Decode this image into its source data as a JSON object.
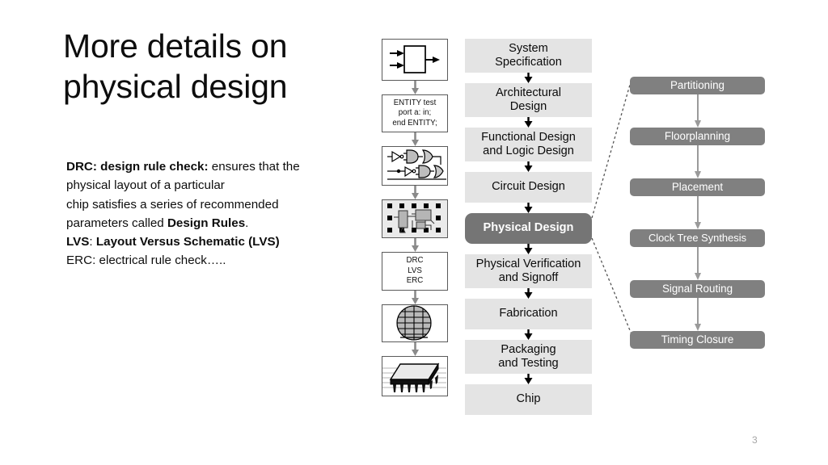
{
  "slide": {
    "title": "More details on physical design",
    "page_number": "3",
    "body": {
      "line1_bold": "DRC: design rule check:",
      "line1_rest": " ensures that  the",
      "line2": "physical layout of a particular",
      "line3": "chip  satisfies a series of recommended",
      "line4_pre": "parameters called ",
      "line4_bold": "Design Rules",
      "line4_post": ".",
      "line5_bold_a": "LVS",
      "line5_rest": ": ",
      "line5_bold_b": "Layout Versus Schematic (LVS)",
      "line6": "ERC: electrical rule check….."
    }
  },
  "colors": {
    "center_box": "#e4e4e4",
    "center_highlight": "#757575",
    "right_box": "#808080",
    "icon_border": "#5a5a5a",
    "arrow": "#7f7f7f",
    "text_dark": "#0b0b0b",
    "text_light": "#ffffff",
    "page_number": "#a6a6a6"
  },
  "icon_column": {
    "name": "design-flow-illustrations",
    "items": [
      {
        "name": "block-diagram-icon",
        "kind": "block-diagram",
        "label": ""
      },
      {
        "name": "hdl-code-icon",
        "kind": "text",
        "label": "ENTITY test\nport a: in;\nend ENTITY;",
        "lines": [
          "ENTITY test",
          "port a: in;",
          "end ENTITY;"
        ]
      },
      {
        "name": "logic-gates-icon",
        "kind": "gates",
        "label": ""
      },
      {
        "name": "chip-layout-icon",
        "kind": "layout",
        "label": ""
      },
      {
        "name": "verification-checks-icon",
        "kind": "text",
        "label": "DRC\nLVS\nERC",
        "lines": [
          "DRC",
          "LVS",
          "ERC"
        ]
      },
      {
        "name": "wafer-icon",
        "kind": "wafer",
        "label": ""
      },
      {
        "name": "packaged-chip-icon",
        "kind": "package",
        "label": ""
      }
    ]
  },
  "center_flow": {
    "name": "vlsi-design-flow",
    "steps": [
      {
        "name": "step-system-specification",
        "lines": [
          "System",
          "Specification"
        ],
        "highlight": false
      },
      {
        "name": "step-architectural-design",
        "lines": [
          "Architectural",
          "Design"
        ],
        "highlight": false
      },
      {
        "name": "step-functional-and-logic-design",
        "lines": [
          "Functional Design",
          "and Logic Design"
        ],
        "highlight": false
      },
      {
        "name": "step-circuit-design",
        "lines": [
          "Circuit Design"
        ],
        "highlight": false
      },
      {
        "name": "step-physical-design",
        "lines": [
          "Physical Design"
        ],
        "highlight": true
      },
      {
        "name": "step-physical-verification-and-signoff",
        "lines": [
          "Physical Verification",
          "and Signoff"
        ],
        "highlight": false
      },
      {
        "name": "step-fabrication",
        "lines": [
          "Fabrication"
        ],
        "highlight": false
      },
      {
        "name": "step-packaging-and-testing",
        "lines": [
          "Packaging",
          "and Testing"
        ],
        "highlight": false
      },
      {
        "name": "step-chip",
        "lines": [
          "Chip"
        ],
        "highlight": false
      }
    ]
  },
  "right_flow": {
    "name": "physical-design-substeps",
    "steps": [
      {
        "name": "substep-partitioning",
        "label": "Partitioning"
      },
      {
        "name": "substep-floorplanning",
        "label": "Floorplanning"
      },
      {
        "name": "substep-placement",
        "label": "Placement"
      },
      {
        "name": "substep-clock-tree-synthesis",
        "label": "Clock Tree Synthesis"
      },
      {
        "name": "substep-signal-routing",
        "label": "Signal Routing"
      },
      {
        "name": "substep-timing-closure",
        "label": "Timing Closure"
      }
    ]
  }
}
